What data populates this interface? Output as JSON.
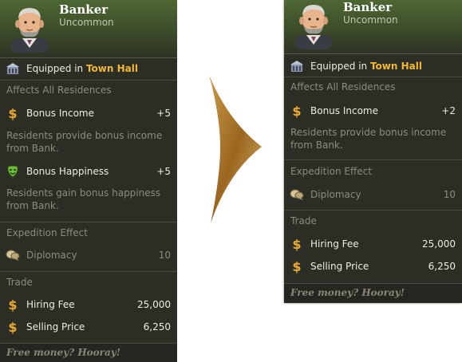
{
  "left": {
    "name": "Banker",
    "rarity": "Uncommon",
    "equipped_prefix": "Equipped in",
    "equipped_location": "Town Hall",
    "affects": "Affects All Residences",
    "bonus_income_label": "Bonus Income",
    "bonus_income_value": "+5",
    "bonus_income_desc": "Residents provide bonus income from Bank.",
    "bonus_happiness_label": "Bonus Happiness",
    "bonus_happiness_value": "+5",
    "bonus_happiness_desc": "Residents gain bonus happiness from Bank.",
    "expedition_heading": "Expedition Effect",
    "diplomacy_label": "Diplomacy",
    "diplomacy_value": "10",
    "trade_heading": "Trade",
    "hiring_fee_label": "Hiring Fee",
    "hiring_fee_value": "25,000",
    "selling_price_label": "Selling Price",
    "selling_price_value": "6,250",
    "flavor": "Free money? Hooray!"
  },
  "right": {
    "name": "Banker",
    "rarity": "Uncommon",
    "equipped_prefix": "Equipped in",
    "equipped_location": "Town Hall",
    "affects": "Affects All Residences",
    "bonus_income_label": "Bonus Income",
    "bonus_income_value": "+2",
    "bonus_income_desc": "Residents provide bonus income from Bank.",
    "expedition_heading": "Expedition Effect",
    "diplomacy_label": "Diplomacy",
    "diplomacy_value": "10",
    "trade_heading": "Trade",
    "hiring_fee_label": "Hiring Fee",
    "hiring_fee_value": "25,000",
    "selling_price_label": "Selling Price",
    "selling_price_value": "6,250",
    "flavor": "Free money? Hooray!"
  },
  "icons": {
    "town_hall": "building-icon",
    "coin": "dollar-icon",
    "mask": "happiness-mask-icon",
    "diplomacy": "speech-bubble-icon",
    "arrow": "arrow-right-icon"
  },
  "colors": {
    "panel_bg": "#2c2d24",
    "header_green": "#4e6733",
    "highlight": "#f2b82e",
    "muted_text": "#8e8b7e",
    "arrow": "#b07d2c"
  }
}
